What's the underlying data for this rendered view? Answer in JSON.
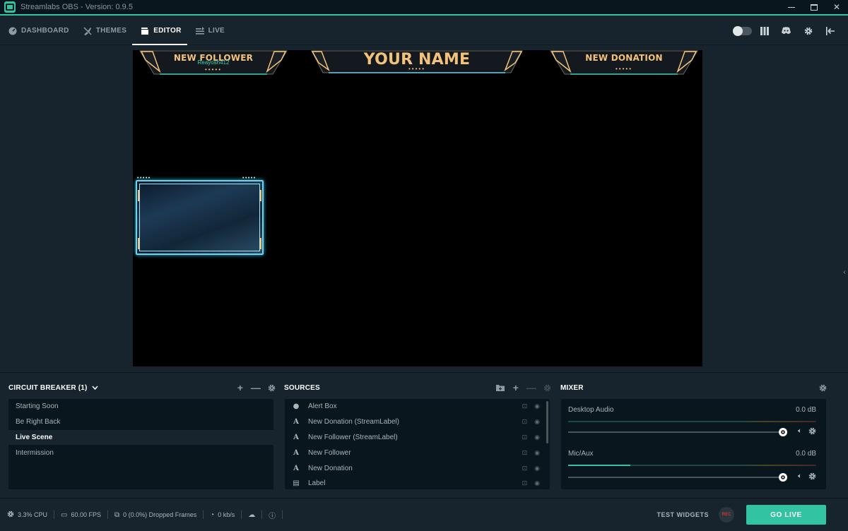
{
  "window": {
    "title": "Streamlabs OBS - Version: 0.9.5"
  },
  "nav": {
    "tabs": [
      {
        "label": "DASHBOARD",
        "icon": "dashboard-gauge-icon"
      },
      {
        "label": "THEMES",
        "icon": "themes-brush-icon"
      },
      {
        "label": "EDITOR",
        "icon": "editor-clapper-icon",
        "active": true
      },
      {
        "label": "LIVE",
        "icon": "live-list-icon"
      }
    ],
    "right_icons": [
      "night-mode-toggle",
      "studio-mode-icon",
      "discord-icon",
      "settings-gear-icon",
      "logout-icon"
    ]
  },
  "canvas": {
    "follower_banner": {
      "title": "NEW FOLLOWER",
      "name": "Reayosh412",
      "dots": "•••••"
    },
    "name_banner": {
      "title": "YOUR NAME",
      "dots": "•••••"
    },
    "donation_banner": {
      "title": "NEW DONATION",
      "dots": "•••••"
    },
    "cam_dots": "•••••"
  },
  "scenes": {
    "title": "CIRCUIT BREAKER (1)",
    "items": [
      "Starting Soon",
      "Be Right Back",
      "Live Scene",
      "Intermission"
    ],
    "active_index": 2
  },
  "sources": {
    "title": "SOURCES",
    "items": [
      {
        "label": "Alert Box",
        "icon": "globe-icon"
      },
      {
        "label": "New Donation (StreamLabel)",
        "icon": "text-icon"
      },
      {
        "label": "New Follower (StreamLabel)",
        "icon": "text-icon"
      },
      {
        "label": "New Follower",
        "icon": "text-icon"
      },
      {
        "label": "New Donation",
        "icon": "text-icon"
      },
      {
        "label": "Label",
        "icon": "file-icon"
      }
    ]
  },
  "mixer": {
    "title": "MIXER",
    "channels": [
      {
        "name": "Desktop Audio",
        "db": "0.0 dB",
        "level": 0,
        "volume": 1.0
      },
      {
        "name": "Mic/Aux",
        "db": "0.0 dB",
        "level": 0.25,
        "volume": 1.0
      }
    ]
  },
  "status": {
    "cpu": "3.3% CPU",
    "fps": "60.00 FPS",
    "dropped": "0 (0.0%) Dropped Frames",
    "bandwidth": "0 kb/s",
    "test_widgets": "TEST WIDGETS",
    "rec": "REC",
    "go_live": "GO LIVE"
  },
  "colors": {
    "accent": "#31c3a2",
    "background": "#17242d",
    "panel": "#09161d",
    "banner_gold": "#f3c27a",
    "cam_frame": "#6fd2ee"
  }
}
